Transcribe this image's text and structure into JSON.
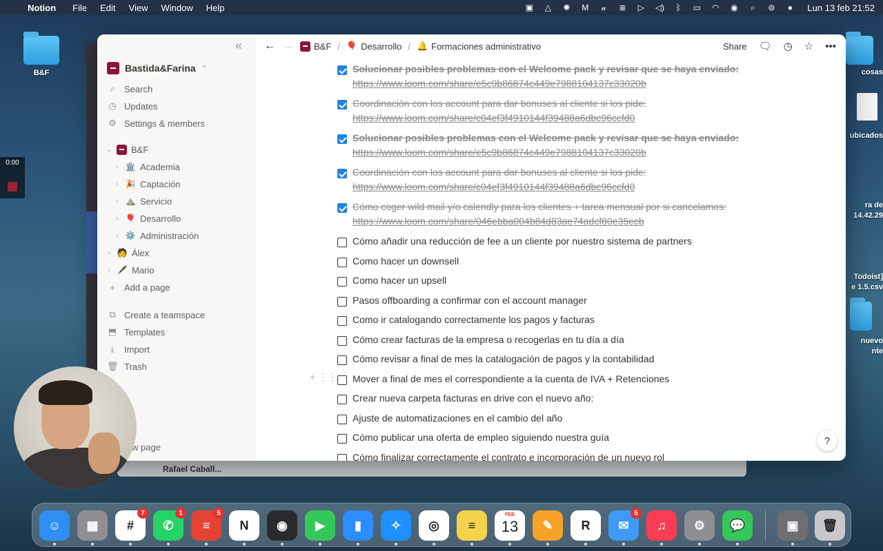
{
  "menubar": {
    "app_name": "Notion",
    "menus": [
      "File",
      "Edit",
      "View",
      "Window",
      "Help"
    ],
    "clock": "Lun 13 feb 21:52"
  },
  "desktop": {
    "folder_label": "B&F",
    "right_labels": [
      "cosas",
      "ubicados",
      "ra de",
      "14.42.29",
      "Todoist]",
      "e 1.5.csv",
      "nuevo",
      "nte"
    ],
    "recorder_time": "0:00",
    "back_panel_text": "Rafael Caball..."
  },
  "notion": {
    "workspace": "Bastida&Farina",
    "sidebar": {
      "top_items": [
        {
          "label": "Search",
          "icon": "search-icon"
        },
        {
          "label": "Updates",
          "icon": "clock-icon"
        },
        {
          "label": "Settings & members",
          "icon": "gear-icon"
        }
      ],
      "tree": [
        {
          "label": "B&F",
          "emoji": "",
          "level": 0
        },
        {
          "label": "Academia",
          "emoji": "🏛️",
          "level": 1
        },
        {
          "label": "Captación",
          "emoji": "🎉",
          "level": 1
        },
        {
          "label": "Servicio",
          "emoji": "⛰️",
          "level": 1
        },
        {
          "label": "Desarrollo",
          "emoji": "🎈",
          "level": 1
        },
        {
          "label": "Administración",
          "emoji": "⚙️",
          "level": 1
        },
        {
          "label": "Álex",
          "emoji": "🧑",
          "level": 0
        },
        {
          "label": "Mario",
          "emoji": "🖋️",
          "level": 0
        }
      ],
      "add_page": "Add a page",
      "bottom_items": [
        {
          "label": "Create a teamspace",
          "icon": "teamspace-icon"
        },
        {
          "label": "Templates",
          "icon": "templates-icon"
        },
        {
          "label": "Import",
          "icon": "import-icon"
        },
        {
          "label": "Trash",
          "icon": "trash-icon"
        }
      ],
      "new_page": "w page"
    },
    "breadcrumb": {
      "items": [
        {
          "label": "B&F",
          "emoji": ""
        },
        {
          "label": "Desarrollo",
          "emoji": "🎈"
        },
        {
          "label": "Formaciones administrativo",
          "emoji": "🔔"
        }
      ],
      "separator": "/"
    },
    "topbar": {
      "share": "Share"
    },
    "todos": [
      {
        "checked": true,
        "bold": true,
        "text": "Solucionar posibles problemas con el Welcome pack y revisar que se haya enviado:",
        "link": "https://www.loom.com/share/e5c9b86874c449e7988104137c33020b"
      },
      {
        "checked": true,
        "bold": false,
        "text": "Coordinación con los account para dar bonuses al cliente si los pide:",
        "link": "https://www.loom.com/share/c04ef3f4910144f39488a6dbc96ccfd0"
      },
      {
        "checked": true,
        "bold": true,
        "text": "Solucionar posibles problemas con el Welcome pack y revisar que se haya enviado:",
        "link": "https://www.loom.com/share/e5c9b86874c449e7988104137c33020b"
      },
      {
        "checked": true,
        "bold": false,
        "text": "Coordinación con los account para dar bonuses al cliente si los pide:",
        "link": "https://www.loom.com/share/c04ef3f4910144f39488a6dbc96ccfd0"
      },
      {
        "checked": true,
        "bold": false,
        "text": "Cómo coger wild mail y/o calendly para los clientes + tarea mensual por si cancelamos:",
        "link": "https://www.loom.com/share/046ebba004b84d83ae74adcf80e35ecb"
      },
      {
        "checked": false,
        "text": "Cómo añadir una reducción de fee a un cliente por nuestro sistema de partners"
      },
      {
        "checked": false,
        "text": "Como hacer un downsell"
      },
      {
        "checked": false,
        "text": "Como hacer un upsell"
      },
      {
        "checked": false,
        "text": "Pasos offboarding a confirmar con el account manager"
      },
      {
        "checked": false,
        "text": "Como ir catalogando correctamente los pagos y facturas"
      },
      {
        "checked": false,
        "text": "Cómo crear facturas de la empresa o recogerlas en tu día a día"
      },
      {
        "checked": false,
        "text": "Cómo revisar a final de mes la catalogación de pagos y la contabilidad"
      },
      {
        "checked": false,
        "text": "Mover a final de mes el correspondiente a la cuenta de IVA + Retenciones"
      },
      {
        "checked": false,
        "text": "Crear nueva carpeta facturas en drive con el nuevo año:"
      },
      {
        "checked": false,
        "text": "Ajuste de automatizaciones en el cambio del año"
      },
      {
        "checked": false,
        "text": "Cómo publicar una oferta de empleo siguiendo nuestra guía"
      },
      {
        "checked": false,
        "text": "Cómo finalizar correctamente el contrato e incorporación de un nuevo rol"
      }
    ],
    "help": "?"
  },
  "dock": {
    "apps": [
      {
        "name": "Finder",
        "color": "#2f8ef2",
        "glyph": "☺"
      },
      {
        "name": "Launchpad",
        "color": "#8e8e93",
        "glyph": "▦"
      },
      {
        "name": "Slack",
        "color": "#ffffff",
        "glyph": "#",
        "badge": "7"
      },
      {
        "name": "WhatsApp",
        "color": "#25d366",
        "glyph": "✆",
        "badge": "1"
      },
      {
        "name": "Todoist",
        "color": "#e44332",
        "glyph": "≡",
        "badge": "5"
      },
      {
        "name": "Notion",
        "color": "#ffffff",
        "glyph": "N"
      },
      {
        "name": "OBS",
        "color": "#2a2a2e",
        "glyph": "◉"
      },
      {
        "name": "FaceTime",
        "color": "#34c759",
        "glyph": "▶"
      },
      {
        "name": "Zoom",
        "color": "#2d8cff",
        "glyph": "▮"
      },
      {
        "name": "Safari",
        "color": "#1e90ff",
        "glyph": "✧"
      },
      {
        "name": "Chrome",
        "color": "#ffffff",
        "glyph": "◎"
      },
      {
        "name": "Notes",
        "color": "#f5d24b",
        "glyph": "≡"
      },
      {
        "name": "Calendar",
        "color": "#ffffff",
        "glyph": "",
        "month": "FEB",
        "day": "13"
      },
      {
        "name": "Pages",
        "color": "#f7a229",
        "glyph": "✎"
      },
      {
        "name": "Readwise",
        "color": "#ffffff",
        "glyph": "R"
      },
      {
        "name": "Mail",
        "color": "#3d9bf5",
        "glyph": "✉",
        "badge": "5"
      },
      {
        "name": "Music",
        "color": "#fa3d55",
        "glyph": "♫"
      },
      {
        "name": "System Settings",
        "color": "#8e8e93",
        "glyph": "⚙"
      },
      {
        "name": "Messages",
        "color": "#34c759",
        "glyph": "💬"
      },
      {
        "name": "Preview",
        "color": "#6e6e73",
        "glyph": "▣"
      },
      {
        "name": "Trash",
        "color": "#c7c7cc",
        "glyph": "🗑"
      }
    ]
  }
}
